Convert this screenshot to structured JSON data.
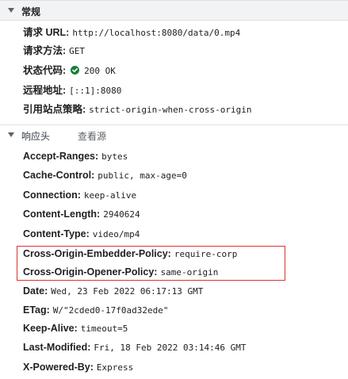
{
  "general": {
    "title": "常规",
    "rows": [
      {
        "name": "请求 URL:",
        "value": "http://localhost:8080/data/0.mp4"
      },
      {
        "name": "请求方法:",
        "value": "GET"
      },
      {
        "name": "状态代码:",
        "value": "200 OK",
        "icon": "green-check-circle-icon",
        "icon_color": "#188038"
      },
      {
        "name": "远程地址:",
        "value": "[::1]:8080"
      },
      {
        "name": "引用站点策略:",
        "value": "strict-origin-when-cross-origin"
      }
    ]
  },
  "response_headers": {
    "title": "响应头",
    "view_source_label": "查看源",
    "rows": [
      {
        "name": "Accept-Ranges:",
        "value": "bytes"
      },
      {
        "name": "Cache-Control:",
        "value": "public, max-age=0"
      },
      {
        "name": "Connection:",
        "value": "keep-alive"
      },
      {
        "name": "Content-Length:",
        "value": "2940624"
      },
      {
        "name": "Content-Type:",
        "value": "video/mp4"
      },
      {
        "name": "Cross-Origin-Embedder-Policy:",
        "value": "require-corp"
      },
      {
        "name": "Cross-Origin-Opener-Policy:",
        "value": "same-origin"
      },
      {
        "name": "Date:",
        "value": "Wed, 23 Feb 2022 06:17:13 GMT"
      },
      {
        "name": "ETag:",
        "value": "W/\"2cded0-17f0ad32ede\""
      },
      {
        "name": "Keep-Alive:",
        "value": "timeout=5"
      },
      {
        "name": "Last-Modified:",
        "value": "Fri, 18 Feb 2022 03:14:46 GMT"
      },
      {
        "name": "X-Powered-By:",
        "value": "Express"
      }
    ]
  },
  "highlight_color": "#d9332f"
}
